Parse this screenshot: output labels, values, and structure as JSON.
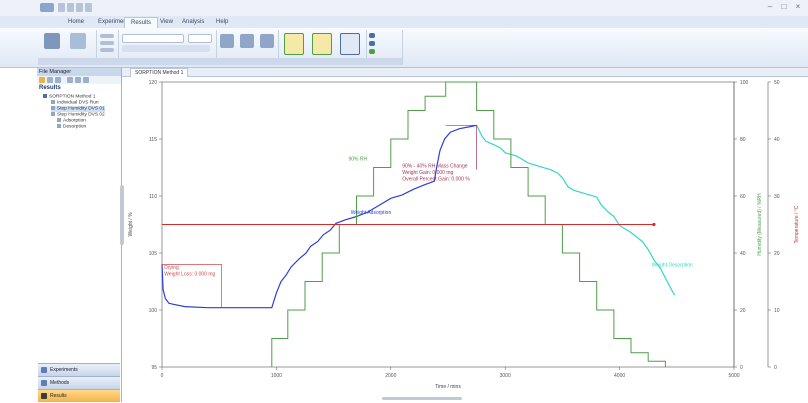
{
  "ribbon": {
    "tabs": [
      "Home",
      "Experiment",
      "Results",
      "View",
      "Analysis",
      "Help"
    ],
    "active_tab_index": 2
  },
  "left_panel": {
    "title": "File Manager",
    "section": "Results",
    "tree": [
      {
        "label": "SORPTION Method 1",
        "indent": 6
      },
      {
        "label": "Individual DVS Run",
        "indent": 14
      },
      {
        "label": "Step Humidity DVS 01",
        "indent": 14
      },
      {
        "label": "Step Humidity DVS 02",
        "indent": 14
      },
      {
        "label": "Adsorption",
        "indent": 20
      },
      {
        "label": "Desorption",
        "indent": 20
      }
    ],
    "nav": [
      "Experiments",
      "Methods",
      "Results"
    ]
  },
  "document_tab": {
    "label": "SORPTION Method 1"
  },
  "colors": {
    "weight_sorption": "#2b3fd6",
    "weight_desorption": "#35d6c8",
    "rh": "#4f9e4a",
    "temp": "#d22d2d",
    "annotation": "#a3355c",
    "drying_box": "#c94b4b"
  },
  "chart_data": {
    "type": "line",
    "x": {
      "label": "Time / mins",
      "range": [
        0,
        5000
      ],
      "ticks": [
        "0",
        "1000",
        "2000",
        "3000",
        "4000",
        "5000"
      ]
    },
    "y_left": {
      "label": "Weight / %",
      "range": [
        95,
        120
      ],
      "ticks": [
        "95",
        "100",
        "105",
        "110",
        "115",
        "120"
      ]
    },
    "y_right1": {
      "label": "Humidity (Measured) / %RH",
      "range": [
        0,
        100
      ],
      "ticks": [
        "0",
        "20",
        "40",
        "60",
        "80",
        "100"
      ]
    },
    "y_right2": {
      "label": "Temperature / °C",
      "range": [
        0,
        50
      ],
      "ticks": [
        "0",
        "10",
        "20",
        "30",
        "40",
        "50"
      ]
    },
    "series": [
      {
        "name": "Weight Adsorption",
        "axis": "left",
        "color_key": "weight_sorption",
        "x": [
          0,
          10,
          30,
          60,
          100,
          200,
          400,
          700,
          960,
          1000,
          1040,
          1080,
          1130,
          1200,
          1260,
          1300,
          1360,
          1410,
          1470,
          1520,
          1600,
          1700,
          1800,
          1900,
          2000,
          2100,
          2200,
          2300,
          2380,
          2400,
          2430,
          2470,
          2520,
          2600,
          2700,
          2750
        ],
        "y": [
          104.0,
          101.8,
          101.0,
          100.6,
          100.5,
          100.3,
          100.2,
          100.2,
          100.2,
          101.5,
          102.5,
          103.0,
          103.8,
          104.5,
          105.0,
          105.6,
          106.0,
          106.6,
          107.0,
          107.6,
          107.9,
          108.2,
          108.6,
          109.2,
          109.8,
          110.1,
          110.6,
          111.0,
          111.3,
          112.5,
          114.0,
          115.0,
          115.6,
          115.9,
          116.1,
          116.2
        ]
      },
      {
        "name": "Weight Desorption",
        "axis": "left",
        "color_key": "weight_desorption",
        "x": [
          2750,
          2800,
          2830,
          2900,
          2960,
          3000,
          3100,
          3150,
          3200,
          3300,
          3400,
          3460,
          3500,
          3550,
          3600,
          3700,
          3800,
          3840,
          3900,
          3950,
          4000,
          4100,
          4200,
          4250,
          4300,
          4360,
          4400,
          4480
        ],
        "y": [
          116.2,
          115.2,
          114.8,
          114.5,
          114.2,
          113.8,
          113.5,
          113.2,
          112.9,
          112.6,
          112.3,
          112.0,
          111.6,
          110.8,
          110.5,
          110.2,
          109.9,
          109.2,
          108.6,
          108.2,
          107.4,
          106.8,
          106.0,
          105.3,
          104.4,
          103.6,
          102.8,
          101.3
        ]
      },
      {
        "name": "RH",
        "axis": "right1",
        "color_key": "rh",
        "x": [
          960,
          960,
          1100,
          1100,
          1250,
          1250,
          1400,
          1400,
          1550,
          1550,
          1700,
          1700,
          1850,
          1850,
          2000,
          2000,
          2150,
          2150,
          2300,
          2300,
          2480,
          2480,
          2750,
          2750,
          2900,
          2900,
          3050,
          3050,
          3200,
          3200,
          3350,
          3350,
          3500,
          3500,
          3650,
          3650,
          3800,
          3800,
          3950,
          3950,
          4100,
          4100,
          4250,
          4250,
          4400,
          4400
        ],
        "y": [
          0,
          10,
          10,
          20,
          20,
          30,
          30,
          40,
          40,
          50,
          50,
          60,
          60,
          70,
          70,
          80,
          80,
          90,
          90,
          95,
          95,
          100,
          100,
          90,
          90,
          80,
          80,
          70,
          70,
          60,
          60,
          50,
          50,
          40,
          40,
          30,
          30,
          20,
          20,
          10,
          10,
          5,
          5,
          2,
          2,
          0
        ]
      },
      {
        "name": "Temperature",
        "axis": "right2",
        "color_key": "temp",
        "x": [
          0,
          4300
        ],
        "y": [
          25,
          25
        ]
      }
    ],
    "annotations": [
      {
        "lines": [
          "Drying",
          "Weight Loss: 0.000 mg"
        ],
        "x": 20,
        "y": 103.6,
        "color_key": "drying_box"
      },
      {
        "lines": [
          "Weight Adsorption"
        ],
        "x": 1650,
        "y": 108.4,
        "color_key": "weight_sorption"
      },
      {
        "lines": [
          "Weight Desorption"
        ],
        "x": 4280,
        "y": 103.8,
        "color_key": "weight_desorption"
      },
      {
        "lines": [
          "90% RH"
        ],
        "x": 1630,
        "y": 113.1,
        "color_key": "rh"
      },
      {
        "lines": [
          "90% - 40% RH Mass Change",
          "Weight Gain: 0.000 mg",
          "Overall Percent Gain: 0.000 %"
        ],
        "x": 2100,
        "y": 112.5,
        "color_key": "annotation"
      }
    ]
  }
}
